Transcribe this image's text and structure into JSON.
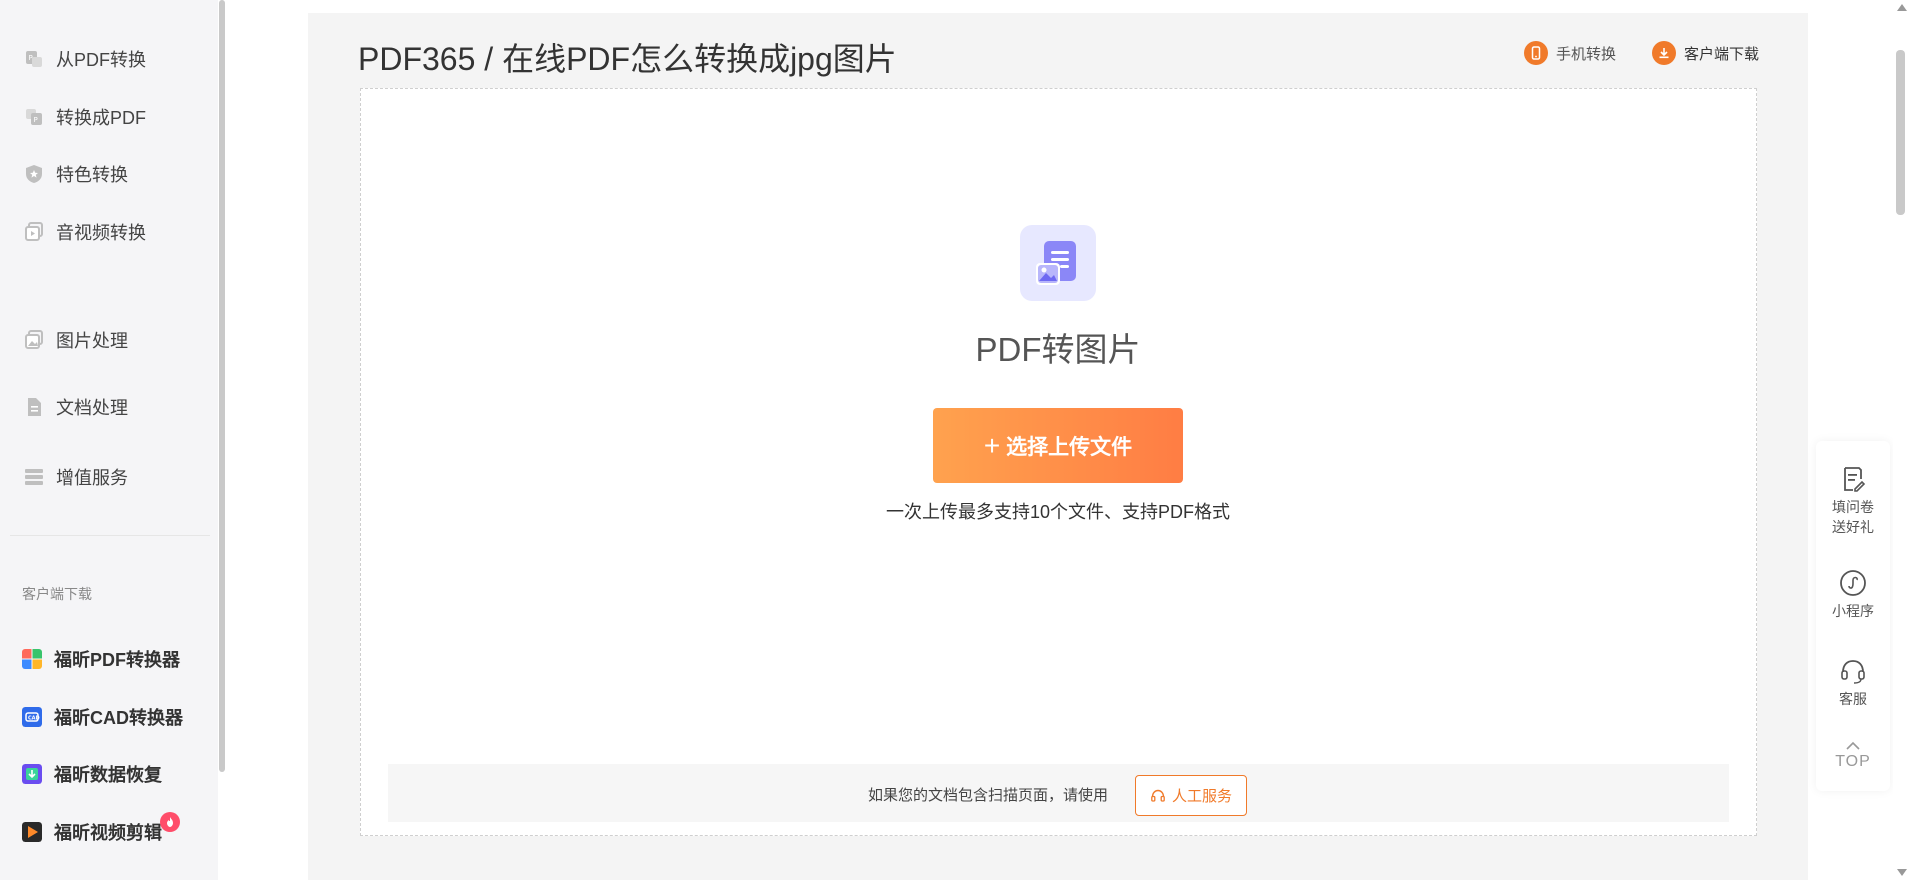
{
  "sidebar": {
    "items": [
      {
        "label": "从PDF转换",
        "icon": "pdf-export-icon"
      },
      {
        "label": "转换成PDF",
        "icon": "pdf-import-icon"
      },
      {
        "label": "特色转换",
        "icon": "shield-star-icon"
      },
      {
        "label": "音视频转换",
        "icon": "media-icon"
      },
      {
        "label": "图片处理",
        "icon": "image-icon"
      },
      {
        "label": "文档处理",
        "icon": "document-icon"
      },
      {
        "label": "增值服务",
        "icon": "list-icon"
      }
    ],
    "section_title": "客户端下载",
    "apps": [
      {
        "label": "福昕PDF转换器",
        "icon": "pdf-converter-app-icon"
      },
      {
        "label": "福昕CAD转换器",
        "icon": "cad-converter-app-icon"
      },
      {
        "label": "福昕数据恢复",
        "icon": "data-recovery-app-icon"
      },
      {
        "label": "福昕视频剪辑",
        "icon": "video-editor-app-icon"
      }
    ]
  },
  "header": {
    "title": "PDF365 / 在线PDF怎么转换成jpg图片",
    "mobile_label": "手机转换",
    "client_label": "客户端下载"
  },
  "main": {
    "tool_title": "PDF转图片",
    "upload_plus": "+",
    "upload_button": "选择上传文件",
    "upload_hint": "一次上传最多支持10个文件、支持PDF格式",
    "scan_text": "如果您的文档包含扫描页面，请使用",
    "service_button": "人工服务"
  },
  "float": {
    "survey": "填问卷送好礼",
    "mini_program": "小程序",
    "support": "客服",
    "top": "TOP"
  },
  "colors": {
    "accent": "#f07a2a",
    "upload_start": "#ffa24e",
    "upload_end": "#ff7d44",
    "icon_bg": "#e7e8ff",
    "icon_main": "#8b87f7"
  }
}
